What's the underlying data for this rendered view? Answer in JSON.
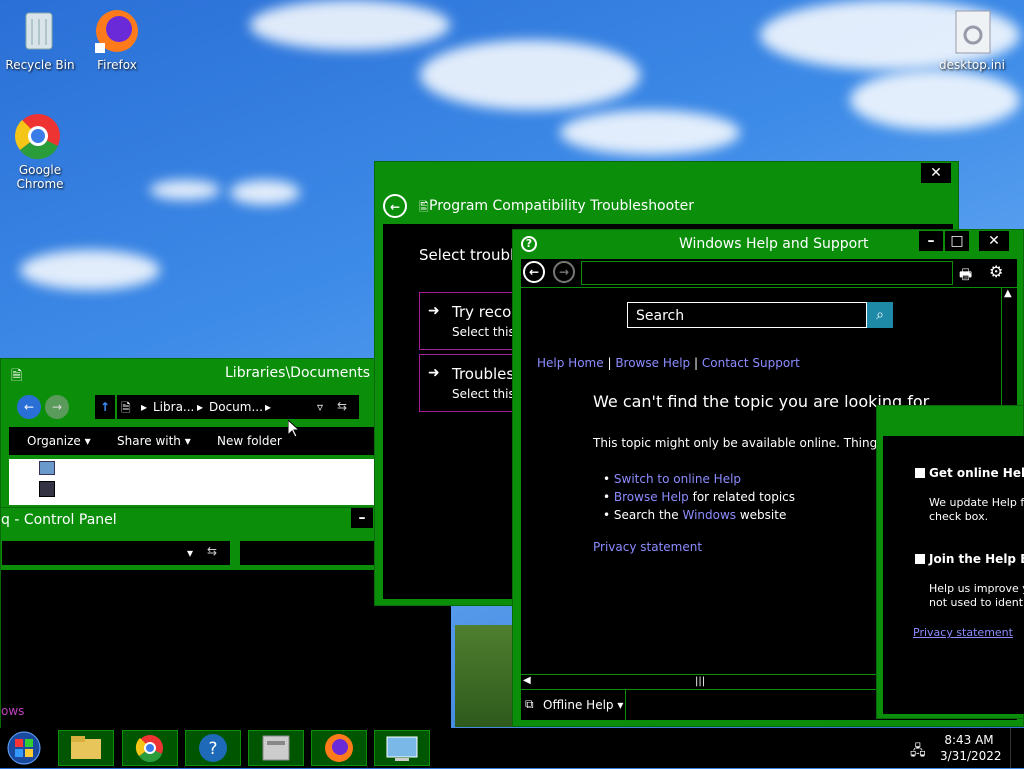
{
  "desktop": {
    "icons": [
      {
        "label": "Recycle Bin"
      },
      {
        "label": "Firefox"
      },
      {
        "label": "Google\nChrome"
      },
      {
        "label": "desktop.ini"
      }
    ]
  },
  "docs_window": {
    "title": "Libraries\\Documents",
    "breadcrumb": [
      "Libra...",
      "Docum..."
    ],
    "toolbar": {
      "organize": "Organize",
      "share": "Share with",
      "new_folder": "New folder"
    }
  },
  "control_panel": {
    "title": "q - Control Panel",
    "partial_left_text": "ows"
  },
  "troubleshooter": {
    "title": "Program Compatibility Troubleshooter",
    "heading": "Select trouble",
    "option1_title": "Try reco",
    "option1_sub": "Select this o",
    "option2_title": "Troubles",
    "option2_sub": "Select this o"
  },
  "help": {
    "title": "Windows Help and Support",
    "search_placeholder": "Search",
    "nav": {
      "home": "Help Home",
      "browse": "Browse Help",
      "contact": "Contact Support",
      "sep": "|"
    },
    "heading": "We can't find the topic you are looking for",
    "body": "This topic might only be available online. Things to try:",
    "bullets": {
      "b1_link": "Switch to online Help",
      "b2_link": "Browse Help",
      "b2_rest": " for related topics",
      "b3_pre": "Search the ",
      "b3_link": "Windows",
      "b3_post": " website"
    },
    "privacy": "Privacy statement",
    "offline": "Offline Help"
  },
  "help_popup": {
    "opt1_title": "Get online Help (",
    "opt1_desc_1": "We update Help freq",
    "opt1_desc_2": "check box.",
    "opt2_title": "Join the Help Exp",
    "opt2_desc_1": "Help us improve you",
    "opt2_desc_2": "not used to identify c",
    "privacy": "Privacy statement"
  },
  "taskbar": {
    "time": "8:43 AM",
    "date": "3/31/2022",
    "items": [
      "start",
      "explorer",
      "chrome",
      "help",
      "control-panel",
      "firefox",
      "remote-desktop"
    ]
  },
  "colors": {
    "accent": "#0b8f0b",
    "link": "#8c8cff",
    "bg": "#000000"
  }
}
